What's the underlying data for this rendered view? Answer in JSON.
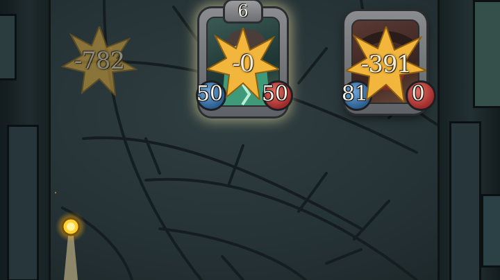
{
  "floating_damage": {
    "value": "-782"
  },
  "cards": [
    {
      "name": "card-selected",
      "cost": "6",
      "damage": "-0",
      "attack": "50",
      "health": "50"
    },
    {
      "name": "card-enemy",
      "damage": "-391",
      "attack": "81",
      "health": "0"
    }
  ],
  "colors": {
    "burst": "#f3b63c",
    "floor": "#2a383b",
    "glow": "#ffd24a"
  },
  "icons": [
    "star-burst-icon",
    "attack-orb-icon",
    "health-orb-icon",
    "glowing-orb-icon"
  ]
}
